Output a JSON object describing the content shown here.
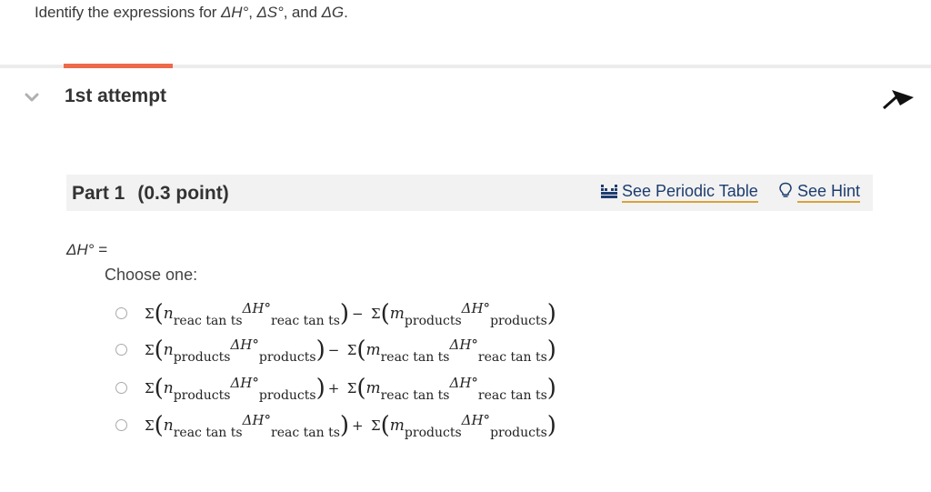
{
  "question": {
    "prefix": "Identify the expressions for ",
    "dh": "ΔH°",
    "sep1": ", ",
    "ds": "ΔS°",
    "sep2": ", and ",
    "dg": "ΔG",
    "suffix": "."
  },
  "attempt": {
    "label": "1st attempt"
  },
  "part": {
    "title": "Part 1",
    "points": "(0.3 point)"
  },
  "tools": {
    "periodic_table": "See Periodic Table",
    "hint": "See Hint"
  },
  "prompt": {
    "variable": "ΔH°",
    "equals": " ="
  },
  "choose_label": "Choose one:",
  "options": [
    {
      "t1": {
        "coef": "n",
        "sub": "reac tan ts",
        "q": "ΔH°",
        "qsub": "reac tan ts"
      },
      "op": "−",
      "t2": {
        "coef": "m",
        "sub": "products",
        "q": "ΔH°",
        "qsub": "products"
      }
    },
    {
      "t1": {
        "coef": "n",
        "sub": "products",
        "q": "ΔH°",
        "qsub": "products"
      },
      "op": "−",
      "t2": {
        "coef": "m",
        "sub": "reac tan ts",
        "q": "ΔH°",
        "qsub": "reac tan ts"
      }
    },
    {
      "t1": {
        "coef": "n",
        "sub": "products",
        "q": "ΔH°",
        "qsub": "products"
      },
      "op": "+",
      "t2": {
        "coef": "m",
        "sub": "reac tan ts",
        "q": "ΔH°",
        "qsub": "reac tan ts"
      }
    },
    {
      "t1": {
        "coef": "n",
        "sub": "reac tan ts",
        "q": "ΔH°",
        "qsub": "reac tan ts"
      },
      "op": "+",
      "t2": {
        "coef": "m",
        "sub": "products",
        "q": "ΔH°",
        "qsub": "products"
      }
    }
  ],
  "symbols": {
    "sigma": "Σ",
    "lparen": "(",
    "rparen": ")"
  },
  "colors": {
    "accent": "#ec6a4a",
    "link": "#1d3d6e",
    "link_underline": "#d9a33a",
    "part_bg": "#f2f2f2"
  },
  "icons": {
    "chevron": "chevron-down-icon",
    "collapse": "collapse-arrow-icon",
    "periodic": "periodic-table-icon",
    "hint": "lightbulb-icon"
  }
}
